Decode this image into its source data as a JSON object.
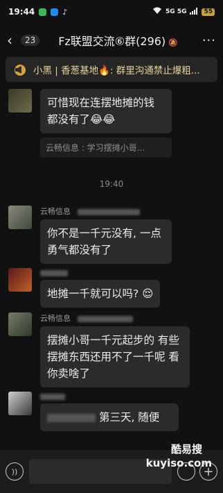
{
  "status_bar": {
    "time": "19:44",
    "network": "5G 5G",
    "battery": "55"
  },
  "nav": {
    "unread": "23",
    "title": "Fz联盟交流⑥群(296)"
  },
  "pinned": {
    "text": "小黑 | 香葱基地🔥: 群里沟通禁止爆粗..."
  },
  "messages": [
    {
      "sender": "",
      "text": "可惜现在连摆地摊的钱都没有了😂😂",
      "quote": "云畅信息 :  学习摆摊小哥..."
    },
    {
      "sender": "云畅信息",
      "text": "你不是一千元没有, 一点勇气都没有了"
    },
    {
      "sender": "",
      "text": "地摊一千就可以吗? 😌"
    },
    {
      "sender": "云畅信息",
      "text": "摆摊小哥一千元起步的  有些摆摊东西还用不了一千呢  看你卖啥了"
    },
    {
      "sender": "",
      "text": "第三天, 随便"
    }
  ],
  "time_divider": "19:40",
  "watermark": {
    "line1": "酷易搜",
    "line2": "kuyiso.com"
  },
  "colors": {
    "background": "#111111",
    "bubble": "#2b2b2b",
    "pinned_text": "#e6d29a"
  }
}
